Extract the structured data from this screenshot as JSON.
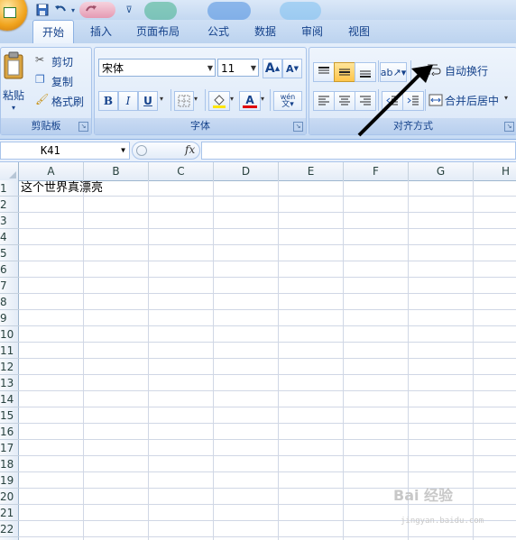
{
  "quick_access": {
    "save_icon": "save-icon",
    "undo_icon": "undo-icon",
    "redo_icon": "redo-icon",
    "customize_icon": "customize-icon"
  },
  "tabs": [
    {
      "label": "开始",
      "active": true
    },
    {
      "label": "插入",
      "active": false
    },
    {
      "label": "页面布局",
      "active": false
    },
    {
      "label": "公式",
      "active": false
    },
    {
      "label": "数据",
      "active": false
    },
    {
      "label": "审阅",
      "active": false
    },
    {
      "label": "视图",
      "active": false
    }
  ],
  "clipboard": {
    "paste": "粘贴",
    "cut": "剪切",
    "copy": "复制",
    "format_painter": "格式刷",
    "group": "剪贴板"
  },
  "font": {
    "name": "宋体",
    "size": "11",
    "bold": "B",
    "italic": "I",
    "underline": "U",
    "grow": "A",
    "shrink": "A",
    "font_color": "A",
    "phonetic": "wén",
    "group": "字体"
  },
  "alignment": {
    "wrap_text": "自动换行",
    "merge_center": "合并后居中",
    "group": "对齐方式"
  },
  "formula_bar": {
    "name_box": "K41",
    "fx": "fx",
    "formula": ""
  },
  "columns": [
    "A",
    "B",
    "C",
    "D",
    "E",
    "F",
    "G",
    "H"
  ],
  "rows": [
    "1",
    "2",
    "3",
    "4",
    "5",
    "6",
    "7",
    "8",
    "9",
    "10",
    "11",
    "12",
    "13",
    "14",
    "15",
    "16",
    "17",
    "18",
    "19",
    "20",
    "21",
    "22"
  ],
  "cells": {
    "A1": "这个世界真漂亮"
  },
  "watermark": {
    "brand": "Bai 经验",
    "url": "jingyan.baidu.com"
  },
  "colors": {
    "accent": "#15428b",
    "annotation_arrow": "#000000"
  }
}
